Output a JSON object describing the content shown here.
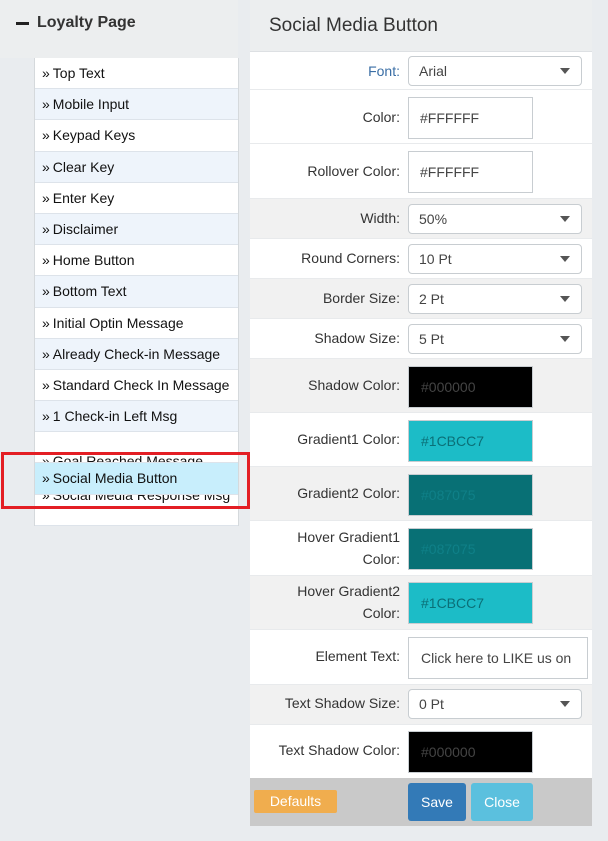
{
  "sidebar": {
    "title": "Loyalty Page",
    "items": [
      {
        "label": "Top Text"
      },
      {
        "label": "Mobile Input"
      },
      {
        "label": "Keypad Keys"
      },
      {
        "label": "Clear Key"
      },
      {
        "label": "Enter Key"
      },
      {
        "label": "Disclaimer"
      },
      {
        "label": "Home Button"
      },
      {
        "label": "Bottom Text"
      },
      {
        "label": "Initial Optin Message"
      },
      {
        "label": "Already Check-in Message"
      },
      {
        "label": "Standard Check In Message"
      },
      {
        "label": "1 Check-in Left Msg"
      },
      {
        "label": "Goal Reached Message"
      },
      {
        "label": "Social Media Button"
      },
      {
        "label": "Social Media Response Msg"
      }
    ],
    "bullet": "»",
    "active_item": "Social Media Button"
  },
  "panel": {
    "title": "Social Media Button",
    "font": {
      "label": "Font:",
      "value": "Arial"
    },
    "color": {
      "label": "Color:",
      "value": "#FFFFFF"
    },
    "rollover_color": {
      "label": "Rollover Color:",
      "value": "#FFFFFF"
    },
    "width": {
      "label": "Width:",
      "value": "50%"
    },
    "round_corners": {
      "label": "Round Corners:",
      "value": "10 Pt"
    },
    "border_size": {
      "label": "Border Size:",
      "value": "2 Pt"
    },
    "shadow_size": {
      "label": "Shadow Size:",
      "value": "5 Pt"
    },
    "shadow_color": {
      "label": "Shadow Color:",
      "value": "#000000",
      "swatch": "#000000",
      "text_color": "#444444"
    },
    "gradient1_color": {
      "label": "Gradient1 Color:",
      "value": "#1CBCC7",
      "swatch": "#1CBCC7",
      "text_color": "#0b6f77"
    },
    "gradient2_color": {
      "label": "Gradient2 Color:",
      "value": "#087075",
      "swatch": "#087075",
      "text_color": "#0f8088"
    },
    "hover_gradient1_color": {
      "label": "Hover Gradient1 Color:",
      "value": "#087075",
      "swatch": "#087075",
      "text_color": "#0f8088"
    },
    "hover_gradient2_color": {
      "label": "Hover Gradient2 Color:",
      "value": "#1CBCC7",
      "swatch": "#1CBCC7",
      "text_color": "#0b6f77"
    },
    "element_text": {
      "label": "Element Text:",
      "value": "Click here to LIKE us on"
    },
    "text_shadow_size": {
      "label": "Text Shadow Size:",
      "value": "0 Pt"
    },
    "text_shadow_color": {
      "label": "Text Shadow Color:",
      "value": "#000000",
      "swatch": "#000000",
      "text_color": "#444444"
    }
  },
  "footer": {
    "defaults_label": "Defaults",
    "save_label": "Save",
    "close_label": "Close"
  },
  "icons": {
    "collapse": "minus-icon",
    "dropdown": "caret-down-icon"
  }
}
